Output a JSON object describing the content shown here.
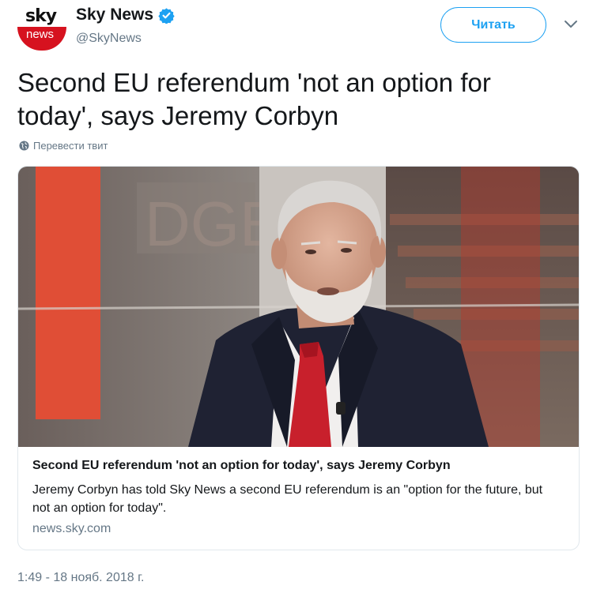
{
  "account": {
    "display_name": "Sky News",
    "handle": "@SkyNews",
    "avatar_top": "sky",
    "avatar_bottom": "news",
    "verified": true
  },
  "follow_button": {
    "label": "Читать"
  },
  "tweet": {
    "text": "Second EU referendum 'not an option for today', says Jeremy Corbyn",
    "translate_label": "Перевести твит",
    "timestamp": "1:49 - 18 нояб. 2018 г."
  },
  "card": {
    "title": "Second EU referendum 'not an option for today', says Jeremy Corbyn",
    "description": "Jeremy Corbyn has told Sky News a second EU referendum is an \"option for the future, but not an option for today\".",
    "domain": "news.sky.com"
  },
  "colors": {
    "accent": "#1da1f2",
    "brand_red": "#d6121f",
    "secondary_text": "#657786"
  },
  "icons": {
    "verified": "verified-badge-icon",
    "caret": "chevron-down-icon",
    "globe": "globe-icon"
  }
}
